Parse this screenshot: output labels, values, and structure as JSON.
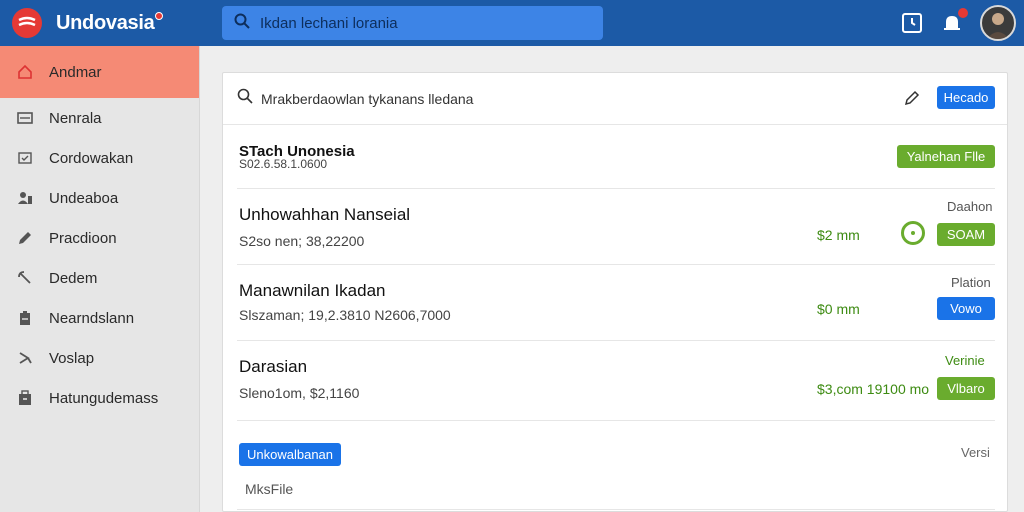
{
  "app": {
    "name": "Undovasia"
  },
  "search": {
    "placeholder": "Ikdan lechani lorania"
  },
  "sidebar": {
    "items": [
      {
        "label": "Andmar",
        "icon": "home-icon"
      },
      {
        "label": "Nenrala",
        "icon": "list-icon"
      },
      {
        "label": "Cordowakan",
        "icon": "checkbox-icon"
      },
      {
        "label": "Undeaboa",
        "icon": "users-icon"
      },
      {
        "label": "Pracdioon",
        "icon": "pencil-icon"
      },
      {
        "label": "Dedem",
        "icon": "wrench-icon"
      },
      {
        "label": "Nearndslann",
        "icon": "clipboard-icon"
      },
      {
        "label": "Voslap",
        "icon": "arrow-icon"
      },
      {
        "label": "Hatungudemass",
        "icon": "archive-icon"
      }
    ]
  },
  "card": {
    "header_query": "Mrakberdaowlan tykanans lledana",
    "header_button": "Hecado",
    "rows": [
      {
        "title": "STach Unonesia",
        "subtitle": "S02.6.58.1.0600",
        "price": "",
        "tag": "",
        "button": "Yalnehan Flle",
        "button_color": "#6aac2e"
      },
      {
        "title": "Unhowahhan Nanseial",
        "subtitle": "S2so nen; 38,22200",
        "price": "$2 mm",
        "tag": "Daahon",
        "button": "SOAM",
        "button_color": "#6aac2e"
      },
      {
        "title": "Manawnilan Ikadan",
        "subtitle": "Slszaman; 19,2.3810 N2606,7000",
        "price": "$0 mm",
        "tag": "Plation",
        "button": "Vowo",
        "button_color": "#1a73e8"
      },
      {
        "title": "Darasian",
        "subtitle": "Sleno1om, $2,1160",
        "price": "$3,com 19100 mo",
        "tag": "Verinie",
        "button": "Vlbaro",
        "button_color": "#6aac2e"
      }
    ],
    "footer_button": "Unkowalbanan",
    "footer_tag": "Versi",
    "footer_text": "MksFile"
  },
  "colors": {
    "topbar": "#1c5aa6",
    "search_bg": "#3d84e6",
    "sidebar_active": "#f58a75",
    "accent_blue": "#1a73e8",
    "accent_green": "#6aac2e",
    "notification": "#e53935"
  }
}
